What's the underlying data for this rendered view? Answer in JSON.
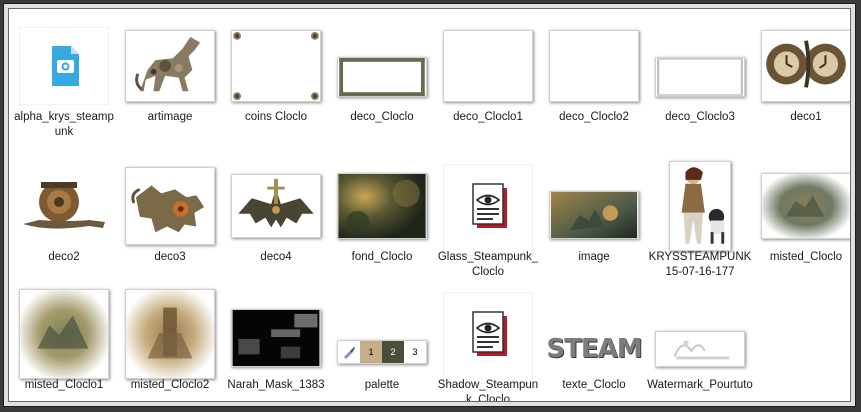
{
  "files": [
    {
      "name": "alpha_krys_steampunk",
      "icon": "image-file-icon"
    },
    {
      "name": "artimage",
      "icon": "horse-thumbnail"
    },
    {
      "name": "coins Cloclo",
      "icon": "corners-thumbnail"
    },
    {
      "name": "deco_Cloclo",
      "icon": "frame-thumbnail"
    },
    {
      "name": "deco_Cloclo1",
      "icon": "blank-thumbnail"
    },
    {
      "name": "deco_Cloclo2",
      "icon": "blank-thumbnail"
    },
    {
      "name": "deco_Cloclo3",
      "icon": "frame-thumbnail"
    },
    {
      "name": "deco1",
      "icon": "clocks-thumbnail"
    },
    {
      "name": "deco2",
      "icon": "snail-thumbnail"
    },
    {
      "name": "deco3",
      "icon": "dragon-thumbnail"
    },
    {
      "name": "deco4",
      "icon": "bat-thumbnail"
    },
    {
      "name": "fond_Cloclo",
      "icon": "blur-thumbnail"
    },
    {
      "name": "Glass_Steampunk_Cloclo",
      "icon": "eye-file-icon"
    },
    {
      "name": "image",
      "icon": "scene-thumbnail"
    },
    {
      "name": "KRYSSTEAMPUNK15-07-16-177",
      "icon": "woman-thumbnail"
    },
    {
      "name": "misted_Cloclo",
      "icon": "misted-thumbnail"
    },
    {
      "name": "misted_Cloclo1",
      "icon": "misted-thumbnail"
    },
    {
      "name": "misted_Cloclo2",
      "icon": "misted-thumbnail"
    },
    {
      "name": "Narah_Mask_1383",
      "icon": "mask-thumbnail"
    },
    {
      "name": "palette",
      "icon": "palette-thumbnail"
    },
    {
      "name": "Shadow_Steampunk_Cloclo",
      "icon": "eye-file-icon"
    },
    {
      "name": "texte_Cloclo",
      "icon": "steam-text-thumbnail"
    },
    {
      "name": "Watermark_Pourtuto",
      "icon": "watermark-thumbnail"
    }
  ],
  "thumb_text": {
    "steam": "STEAM",
    "palette_swatches": [
      "1",
      "2",
      "3"
    ]
  },
  "colors": {
    "swatch_tan": "#c8ad86",
    "swatch_olive": "#4b4f3a",
    "swatch_dark": "#2d2d26",
    "eye_red": "#b11d2a"
  }
}
